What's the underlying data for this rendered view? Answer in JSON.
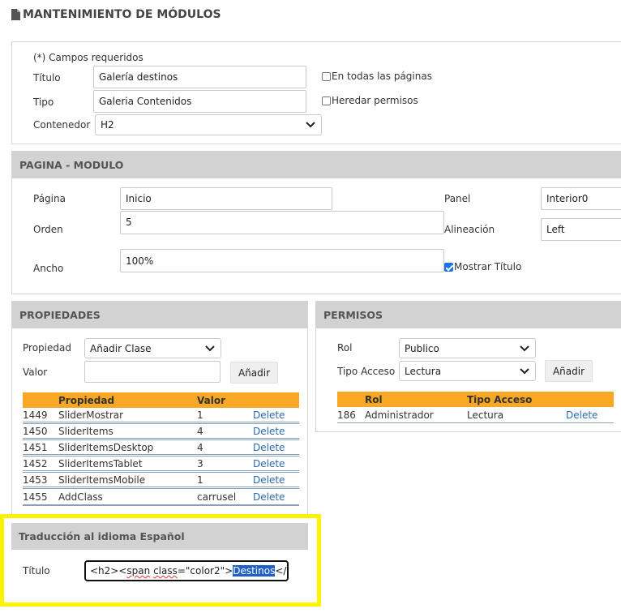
{
  "page_title": "MANTENIMIENTO DE MÓDULOS",
  "module_form": {
    "required_note": "(*) Campos requeridos",
    "titulo_label": "Título",
    "titulo_value": "Galería destinos",
    "tipo_label": "Tipo",
    "tipo_value": "Galeria Contenidos",
    "contenedor_label": "Contenedor",
    "contenedor_value": "H2",
    "todas_paginas_label": "En todas las páginas",
    "heredar_permisos_label": "Heredar permisos"
  },
  "pagina_modulo": {
    "header": "PAGINA - MODULO",
    "pagina_label": "Página",
    "pagina_value": "Inicio",
    "orden_label": "Orden",
    "orden_value": "5",
    "ancho_label": "Ancho",
    "ancho_value": "100%",
    "panel_label": "Panel",
    "panel_value": "Interior0",
    "alineacion_label": "Alineación",
    "alineacion_value": "Left",
    "mostrar_titulo_label": "Mostrar Título",
    "mostrar_titulo_checked": true
  },
  "propiedades": {
    "header": "PROPIEDADES",
    "propiedad_label": "Propiedad",
    "propiedad_value": "Añadir Clase",
    "valor_label": "Valor",
    "valor_value": "",
    "add_button": "Añadir",
    "columns": [
      "Propiedad",
      "Valor"
    ],
    "rows": [
      {
        "id": "1449",
        "propiedad": "SliderMostrar",
        "valor": "1",
        "action": "Delete"
      },
      {
        "id": "1450",
        "propiedad": "SliderItems",
        "valor": "4",
        "action": "Delete"
      },
      {
        "id": "1451",
        "propiedad": "SliderItemsDesktop",
        "valor": "4",
        "action": "Delete"
      },
      {
        "id": "1452",
        "propiedad": "SliderItemsTablet",
        "valor": "3",
        "action": "Delete"
      },
      {
        "id": "1453",
        "propiedad": "SliderItemsMobile",
        "valor": "1",
        "action": "Delete"
      },
      {
        "id": "1455",
        "propiedad": "AddClass",
        "valor": "carrusel",
        "action": "Delete"
      }
    ]
  },
  "permisos": {
    "header": "PERMISOS",
    "rol_label": "Rol",
    "rol_value": "Publico",
    "tipo_acceso_label": "Tipo Acceso",
    "tipo_acceso_value": "Lectura",
    "add_button": "Añadir",
    "columns": [
      "Rol",
      "Tipo Acceso"
    ],
    "rows": [
      {
        "id": "186",
        "rol": "Administrador",
        "tipo_acceso": "Lectura",
        "action": "Delete"
      }
    ]
  },
  "traduccion": {
    "header": "Traducción al idioma Español",
    "titulo_label": "Título",
    "titulo_code_prefix": "<h2><",
    "titulo_code_span": "span",
    "titulo_code_class": "class",
    "titulo_code_mid": "=\"color2\">",
    "titulo_code_selected": "Destinos",
    "titulo_code_suffix": "</spam"
  },
  "colors": {
    "table_header": "#f9a825",
    "panel_header": "#d2d2d2",
    "highlight": "#fff200",
    "link": "#2b6cb0",
    "selection": "#1e60c8"
  }
}
